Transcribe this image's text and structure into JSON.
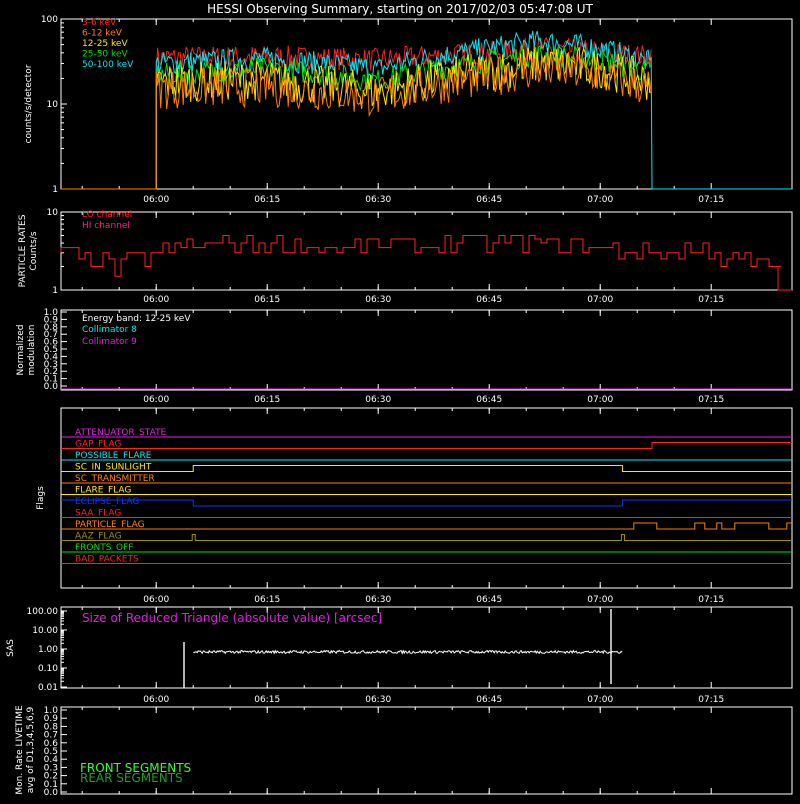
{
  "title": "HESSI Observing Summary, starting on 2017/02/03 05:47:08 UT",
  "time_ticks": [
    "06:00",
    "06:15",
    "06:30",
    "06:45",
    "07:00",
    "07:15"
  ],
  "colors": {
    "red": "#ff2020",
    "orange": "#ff8000",
    "yellow": "#ffe600",
    "green": "#00e000",
    "cyan": "#00e8f0",
    "magenta": "#e020e0",
    "white": "#ffffff",
    "blue": "#1030ff",
    "olive": "#a09000",
    "lime": "#30ff30",
    "darkgreen": "#20a020"
  },
  "panel1": {
    "ylabel": "counts/s/detector",
    "ytick_labels": [
      "1",
      "10",
      "100"
    ],
    "legend": [
      "3-6 keV",
      "6-12 keV",
      "12-25 keV",
      "25-50 keV",
      "50-100 keV"
    ]
  },
  "panel2": {
    "ylabel_line1": "PARTICLE RATES",
    "ylabel_line2": "Counts/s",
    "ytick_labels": [
      "1",
      "10"
    ],
    "legend": [
      "LO channel",
      "HI channel"
    ]
  },
  "panel3": {
    "ylabel_line1": "Normalized",
    "ylabel_line2": "modulation",
    "ytick_labels": [
      "0.0",
      "0.1",
      "0.2",
      "0.3",
      "0.4",
      "0.5",
      "0.6",
      "0.7",
      "0.8",
      "0.9",
      "1.0"
    ],
    "energy_band": "Energy band: 12-25 keV",
    "legend": [
      "Collimator 8",
      "Collimator 9"
    ]
  },
  "panel4": {
    "ylabel": "Flags",
    "flags": [
      "ATTENUATOR_STATE",
      "GAP_FLAG",
      "POSSIBLE_FLARE",
      "SC_IN_SUNLIGHT",
      "SC_TRANSMITTER",
      "FLARE_FLAG",
      "ECLIPSE_FLAG",
      "SAA_FLAG",
      "PARTICLE_FLAG",
      "AAZ_FLAG",
      "FRONTS_OFF",
      "BAD_PACKETS"
    ]
  },
  "panel5": {
    "ylabel": "SAS",
    "ytick_labels": [
      "0.01",
      "0.10",
      "1.00",
      "10.00",
      "100.00"
    ],
    "annotation": "Size of Reduced Triangle (absolute value) [arcsec]"
  },
  "panel6": {
    "ylabel_line1": "Mon. Rate LIVETIME",
    "ylabel_line2": "avg of D1,3,4,5,6,9",
    "ytick_labels": [
      "0.0",
      "0.1",
      "0.2",
      "0.3",
      "0.4",
      "0.5",
      "0.6",
      "0.7",
      "0.8",
      "0.9",
      "1.0"
    ],
    "legend": [
      "FRONT SEGMENTS",
      "REAR SEGMENTS"
    ]
  },
  "chart_data": [
    {
      "type": "line",
      "ylabel": "counts/s/detector",
      "yscale": "log",
      "ylim": [
        1,
        100
      ],
      "x_range": [
        "05:47:08",
        "07:30"
      ],
      "data_window": [
        "06:00",
        "07:07"
      ],
      "series": [
        {
          "name": "3-6 keV",
          "times": [
            "06:00",
            "06:15",
            "06:30",
            "06:45",
            "06:52",
            "07:00",
            "07:07"
          ],
          "values": [
            35,
            36,
            33,
            40,
            45,
            40,
            36
          ]
        },
        {
          "name": "6-12 keV",
          "times": [
            "06:00",
            "06:15",
            "06:30",
            "06:45",
            "06:52",
            "07:00",
            "07:07"
          ],
          "values": [
            15,
            16,
            12,
            21,
            26,
            22,
            15
          ]
        },
        {
          "name": "12-25 keV",
          "times": [
            "06:00",
            "06:15",
            "06:30",
            "06:45",
            "06:52",
            "07:00",
            "07:07"
          ],
          "values": [
            18,
            19,
            14,
            24,
            30,
            26,
            18
          ]
        },
        {
          "name": "25-50 keV",
          "times": [
            "06:00",
            "06:15",
            "06:30",
            "06:45",
            "06:52",
            "07:00",
            "07:07"
          ],
          "values": [
            22,
            26,
            19,
            32,
            38,
            33,
            23
          ]
        },
        {
          "name": "50-100 keV",
          "times": [
            "06:00",
            "06:15",
            "06:30",
            "06:45",
            "06:52",
            "07:00",
            "07:07"
          ],
          "values": [
            30,
            34,
            26,
            45,
            55,
            45,
            30
          ]
        }
      ]
    },
    {
      "type": "line",
      "ylabel": "PARTICLE RATES Counts/s",
      "yscale": "log",
      "ylim": [
        1,
        10
      ],
      "series": [
        {
          "name": "LO channel",
          "times": [
            "05:47",
            "05:55",
            "06:00",
            "06:08",
            "06:30",
            "06:45",
            "07:00",
            "07:05",
            "07:15",
            "07:29"
          ],
          "values": [
            3,
            2,
            3,
            4,
            3.5,
            4,
            3.5,
            3,
            3,
            1
          ]
        }
      ]
    },
    {
      "type": "line",
      "ylabel": "Normalized modulation",
      "ylim": [
        0,
        1
      ],
      "series": [
        {
          "name": "Collimator 9",
          "times": [
            "05:47",
            "07:30"
          ],
          "values": [
            0,
            0
          ]
        }
      ]
    },
    {
      "type": "table",
      "ylabel": "Flags",
      "columns": [
        "flag",
        "state"
      ],
      "rows": [
        [
          "ATTENUATOR_STATE",
          "off"
        ],
        [
          "GAP_FLAG",
          "on after 07:07"
        ],
        [
          "POSSIBLE_FLARE",
          "off"
        ],
        [
          "SC_IN_SUNLIGHT",
          "on 06:05-07:03"
        ],
        [
          "SC_TRANSMITTER",
          "off"
        ],
        [
          "FLARE_FLAG",
          "off"
        ],
        [
          "ECLIPSE_FLAG",
          "on before 06:05 and after 07:03"
        ],
        [
          "SAA_FLAG",
          "off"
        ],
        [
          "PARTICLE_FLAG",
          "intermittent after 07:04"
        ],
        [
          "AAZ_FLAG",
          "spikes at 06:05 and 07:03"
        ],
        [
          "FRONTS_OFF",
          "off"
        ],
        [
          "BAD_PACKETS",
          "off"
        ]
      ]
    },
    {
      "type": "line",
      "ylabel": "SAS",
      "yscale": "log",
      "ylim": [
        0.01,
        100
      ],
      "series": [
        {
          "name": "Size of Reduced Triangle (absolute value) [arcsec]",
          "times": [
            "06:05",
            "06:15",
            "06:30",
            "06:45",
            "07:00",
            "07:03"
          ],
          "values": [
            0.7,
            0.7,
            0.7,
            0.7,
            0.7,
            0.7
          ]
        }
      ]
    },
    {
      "type": "line",
      "ylabel": "Mon. Rate LIVETIME avg of D1,3,4,5,6,9",
      "ylim": [
        0,
        1
      ],
      "series": []
    }
  ]
}
